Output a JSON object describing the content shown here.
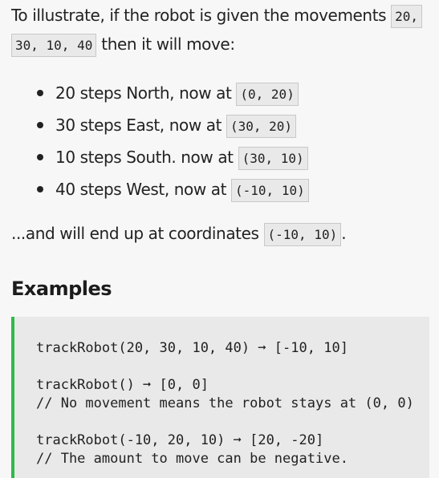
{
  "intro": {
    "text_before": "To illustrate, if the robot is given the movements ",
    "movements_code_part1": "20,",
    "movements_code_part2": "30, 10, 40",
    "text_after": " then it will move:"
  },
  "steps": [
    {
      "text": "20 steps North, now at ",
      "coord": "(0, 20)"
    },
    {
      "text": "30 steps East, now at ",
      "coord": "(30, 20)"
    },
    {
      "text": "10 steps South. now at ",
      "coord": "(30, 10)"
    },
    {
      "text": "40 steps West, now at ",
      "coord": "(-10, 10)"
    }
  ],
  "summary": {
    "text_before": "...and will end up at coordinates ",
    "coord": "(-10, 10)",
    "text_after": "."
  },
  "examples": {
    "title": "Examples",
    "lines": [
      "trackRobot(20, 30, 10, 40) ➞ [-10, 10]",
      "trackRobot() ➞ [0, 0]",
      "// No movement means the robot stays at (0, 0)",
      "trackRobot(-10, 20, 10) ➞ [20, -20]",
      "// The amount to move can be negative."
    ],
    "accent_color": "#2fba4a"
  }
}
